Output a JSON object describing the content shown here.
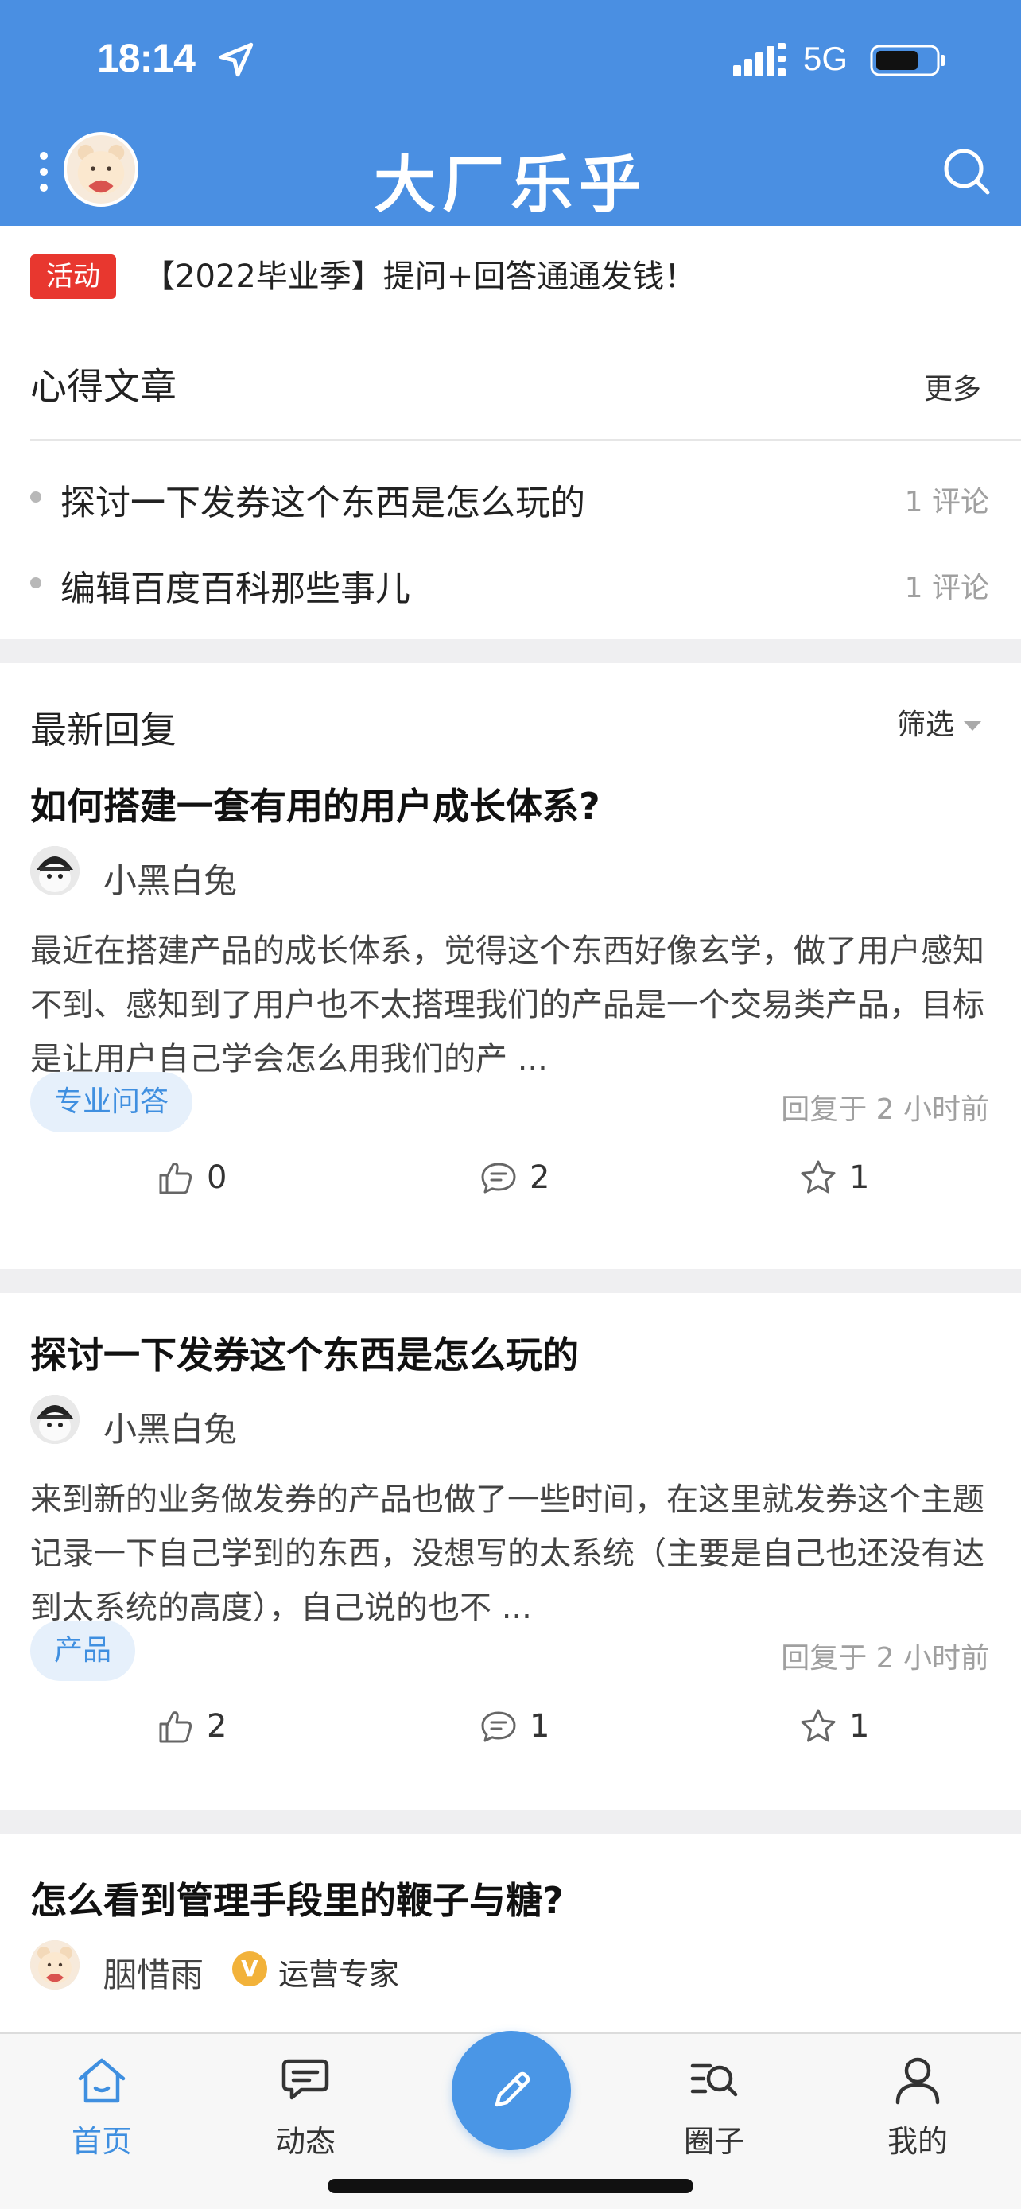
{
  "status": {
    "time": "18:14",
    "network": "5G"
  },
  "header": {
    "title": "大厂乐乎"
  },
  "banner": {
    "tag": "活动",
    "text": "【2022毕业季】提问+回答通通发钱！"
  },
  "articles": {
    "title": "心得文章",
    "more": "更多",
    "items": [
      {
        "title": "探讨一下发券这个东西是怎么玩的",
        "count": "1 评论"
      },
      {
        "title": "编辑百度百科那些事儿",
        "count": "1 评论"
      }
    ]
  },
  "feed": {
    "title": "最新回复",
    "filter": "筛选",
    "posts": [
      {
        "title": "如何搭建一套有用的用户成长体系?",
        "author": "小黑白兔",
        "body": "最近在搭建产品的成长体系，觉得这个东西好像玄学，做了用户感知不到、感知到了用户也不太搭理我们的产品是一个交易类产品，目标是让用户自己学会怎么用我们的产 ...",
        "tag": "专业问答",
        "time": "回复于 2 小时前",
        "likes": "0",
        "comments": "2",
        "stars": "1"
      },
      {
        "title": "探讨一下发券这个东西是怎么玩的",
        "author": "小黑白兔",
        "body": "来到新的业务做发券的产品也做了一些时间，在这里就发券这个主题记录一下自己学到的东西，没想写的太系统（主要是自己也还没有达到太系统的高度），自己说的也不 ...",
        "tag": "产品",
        "time": "回复于 2 小时前",
        "likes": "2",
        "comments": "1",
        "stars": "1"
      },
      {
        "title": "怎么看到管理手段里的鞭子与糖?",
        "author": "胭惜雨",
        "badge": "运营专家",
        "badge_letter": "V"
      }
    ]
  },
  "tabbar": {
    "items": [
      {
        "label": "首页",
        "icon": "home-icon",
        "active": true
      },
      {
        "label": "动态",
        "icon": "chat-icon",
        "active": false
      },
      {
        "label": "圈子",
        "icon": "circle-search-icon",
        "active": false
      },
      {
        "label": "我的",
        "icon": "user-icon",
        "active": false
      }
    ]
  },
  "colors": {
    "brand": "#4a8fe2",
    "accent": "#3f8fe0",
    "event_tag": "#e8372f",
    "badge": "#f2b23a"
  }
}
